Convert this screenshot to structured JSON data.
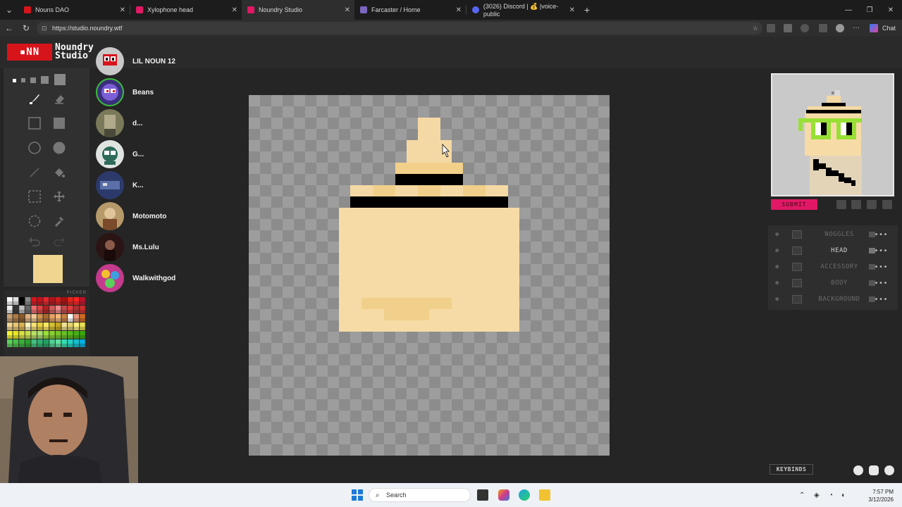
{
  "browser": {
    "tabs": [
      {
        "title": "Nouns DAO",
        "color": "#d8141b",
        "active": false
      },
      {
        "title": "Xylophone head",
        "color": "#e21866",
        "active": false
      },
      {
        "title": "Noundry Studio",
        "color": "#e21866",
        "active": true
      },
      {
        "title": "Farcaster / Home",
        "color": "#7c65c1",
        "active": false
      },
      {
        "title": "(3026) Discord | 💰 |voice-public",
        "color": "#5865f2",
        "active": false
      }
    ],
    "url": "https://studio.noundry.wtf",
    "chat_label": "Chat"
  },
  "app": {
    "logo_mark": "▪NN",
    "logo_line1": "Noundry",
    "logo_line2": "Studio",
    "selected_color": "#f0d591",
    "picker_label": "PICKER"
  },
  "users": [
    {
      "name": "LIL NOUN 12",
      "ring": false,
      "color": "#c9c9c9"
    },
    {
      "name": "Beans",
      "ring": true,
      "color": "#3a2f7a"
    },
    {
      "name": "d...",
      "ring": false,
      "color": "#7a7a5a"
    },
    {
      "name": "G...",
      "ring": false,
      "color": "#dfe4e0"
    },
    {
      "name": "K...",
      "ring": false,
      "color": "#2c3a6b"
    },
    {
      "name": "Motomoto",
      "ring": false,
      "color": "#b79a6a"
    },
    {
      "name": "Ms.Lulu",
      "ring": false,
      "color": "#2a1414"
    },
    {
      "name": "Walkwithgod",
      "ring": false,
      "color": "#c43a8c"
    }
  ],
  "right_panel": {
    "submit_label": "SUBMIT",
    "layers": [
      {
        "name": "NOGGLES",
        "active": false
      },
      {
        "name": "HEAD",
        "active": true
      },
      {
        "name": "ACCESSORY",
        "active": false
      },
      {
        "name": "BODY",
        "active": false
      },
      {
        "name": "BACKGROUND",
        "active": false
      }
    ],
    "keybinds_label": "KEYBINDS"
  },
  "taskbar": {
    "search_placeholder": "Search",
    "time": "7:57 PM",
    "date": "3/12/2026"
  }
}
